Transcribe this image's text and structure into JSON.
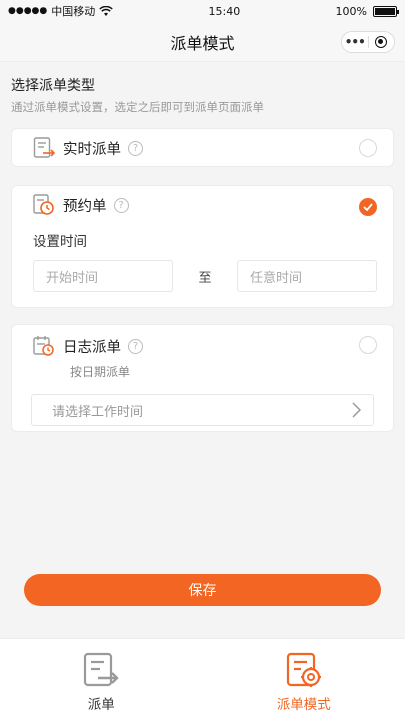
{
  "status_bar": {
    "carrier": "中国移动",
    "time": "15:40",
    "battery": "100%"
  },
  "nav": {
    "title": "派单模式"
  },
  "section": {
    "title": "选择派单类型",
    "subtitle": "通过派单模式设置，选定之后即可到派单页面派单"
  },
  "options": {
    "realtime": {
      "label": "实时派单",
      "help": "?",
      "selected": false
    },
    "appointment": {
      "label": "预约单",
      "help": "?",
      "selected": true,
      "set_time_label": "设置时间",
      "start_placeholder": "开始时间",
      "separator": "至",
      "end_placeholder": "任意时间"
    },
    "daily": {
      "label": "日志派单",
      "help": "?",
      "selected": false,
      "sublabel": "按日期派单",
      "select_placeholder": "请选择工作时间"
    }
  },
  "save_label": "保存",
  "tabs": [
    {
      "label": "派单",
      "icon": "dispatch-icon",
      "active": false
    },
    {
      "label": "派单模式",
      "icon": "dispatch-settings-icon",
      "active": true
    }
  ],
  "colors": {
    "accent": "#f26522",
    "icon_gray": "#9a9a9a"
  }
}
